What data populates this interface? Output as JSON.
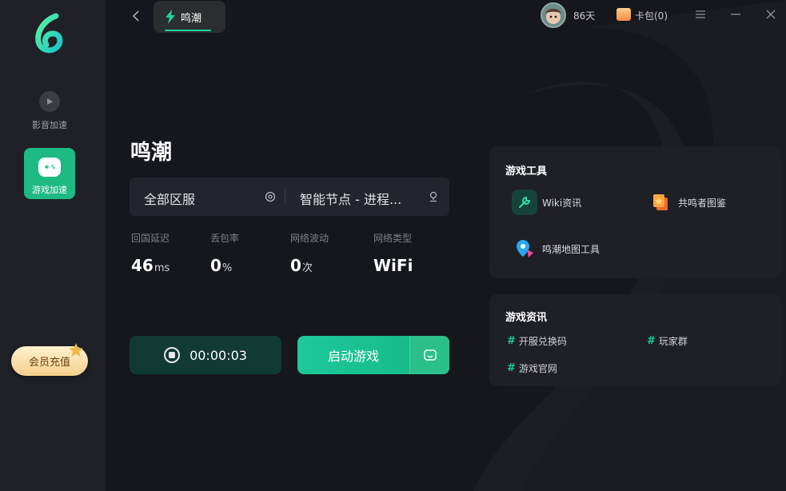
{
  "sidebar": {
    "logo_icon": "app-logo-icon",
    "items": [
      {
        "label": "影音加速",
        "icon": "play-icon",
        "active": false
      },
      {
        "label": "游戏加速",
        "icon": "gamepad-icon",
        "active": true
      }
    ],
    "vip_button": "会员充值"
  },
  "topbar": {
    "tab_label": "鸣潮",
    "days": "86天",
    "card_label": "卡包(0)"
  },
  "game": {
    "title": "鸣潮",
    "region": "全部区服",
    "node": "智能节点 - 进程...",
    "stats": [
      {
        "label": "回国延迟",
        "value": "46",
        "unit": "ms"
      },
      {
        "label": "丢包率",
        "value": "0",
        "unit": "%"
      },
      {
        "label": "网络波动",
        "value": "0",
        "unit": "次"
      },
      {
        "label": "网络类型",
        "value": "WiFi",
        "unit": ""
      }
    ],
    "timer": "00:00:03",
    "launch_label": "启动游戏"
  },
  "tools_panel": {
    "title": "游戏工具",
    "items": [
      {
        "label": "Wiki资讯",
        "icon": "wrench-icon"
      },
      {
        "label": "共鸣者图鉴",
        "icon": "card-stack-icon"
      },
      {
        "label": "鸣潮地图工具",
        "icon": "map-pin-icon"
      }
    ]
  },
  "news_panel": {
    "title": "游戏资讯",
    "links": [
      {
        "label": "开服兑换码"
      },
      {
        "label": "玩家群"
      },
      {
        "label": "游戏官网"
      }
    ]
  },
  "colors": {
    "accent": "#1fc991",
    "sidebar_bg": "#1f2126",
    "main_bg": "#15171c",
    "panel_bg": "#1e2025"
  }
}
